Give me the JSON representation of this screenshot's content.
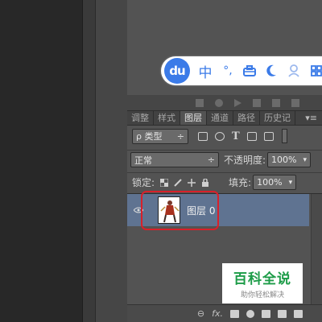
{
  "ime": {
    "logo": "du",
    "items": [
      "中",
      "°,",
      "toolbox-icon",
      "moon-icon",
      "user-icon",
      "grid-icon"
    ],
    "chinese": "中",
    "punct": "°,"
  },
  "tabs": [
    {
      "label": "调整",
      "active": false
    },
    {
      "label": "样式",
      "active": false
    },
    {
      "label": "图层",
      "active": true
    },
    {
      "label": "通道",
      "active": false
    },
    {
      "label": "路径",
      "active": false
    },
    {
      "label": "历史记",
      "active": false
    }
  ],
  "tab_menu": "▾≡",
  "filter": {
    "label": "ρ 类型",
    "arrow": "÷"
  },
  "blend": {
    "mode": "正常",
    "arrow": "÷",
    "opacity_label": "不透明度:",
    "opacity_value": "100%"
  },
  "lock": {
    "label": "锁定:",
    "fill_label": "填充:",
    "fill_value": "100%"
  },
  "layer": {
    "name": "图层 0",
    "visible": true
  },
  "watermark": {
    "title": "百科全说",
    "subtitle": "助你轻松解决"
  },
  "bottom": {
    "link": "⊖",
    "fx": "fx."
  },
  "colors": {
    "panel": "#535353",
    "selected_layer": "#5f7391",
    "highlight": "#d8202a",
    "ime_accent": "#3b7be8",
    "watermark_green": "#1d9c48"
  }
}
